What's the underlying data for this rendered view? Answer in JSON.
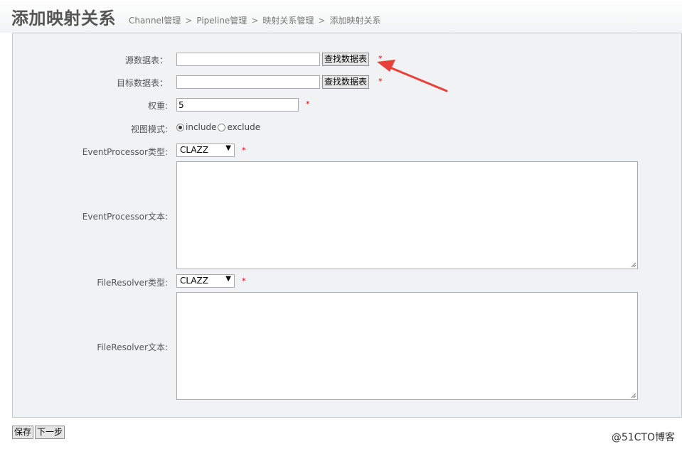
{
  "header": {
    "title": "添加映射关系",
    "breadcrumb": [
      "Channel管理",
      "Pipeline管理",
      "映射关系管理",
      "添加映射关系"
    ],
    "separator": ">"
  },
  "form": {
    "source_table": {
      "label": "源数据表：",
      "value": "",
      "button": "查找数据表"
    },
    "target_table": {
      "label": "目标数据表：",
      "value": "",
      "button": "查找数据表"
    },
    "weight": {
      "label": "权重:",
      "value": "5"
    },
    "view_mode": {
      "label": "视图模式:",
      "options": [
        "include",
        "exclude"
      ],
      "selected": "include"
    },
    "event_processor_type": {
      "label": "EventProcessor类型:",
      "value": "CLAZZ"
    },
    "event_processor_text": {
      "label": "EventProcessor文本:",
      "value": ""
    },
    "file_resolver_type": {
      "label": "FileResolver类型:",
      "value": "CLAZZ"
    },
    "file_resolver_text": {
      "label": "FileResolver文本:",
      "value": ""
    },
    "required_mark": "*"
  },
  "actions": {
    "save": "保存",
    "next": "下一步"
  },
  "watermark": "@51CTO博客",
  "colors": {
    "annotation_arrow": "#e8403a",
    "required": "#dd0000",
    "panel_bg": "#f1f2f3"
  }
}
